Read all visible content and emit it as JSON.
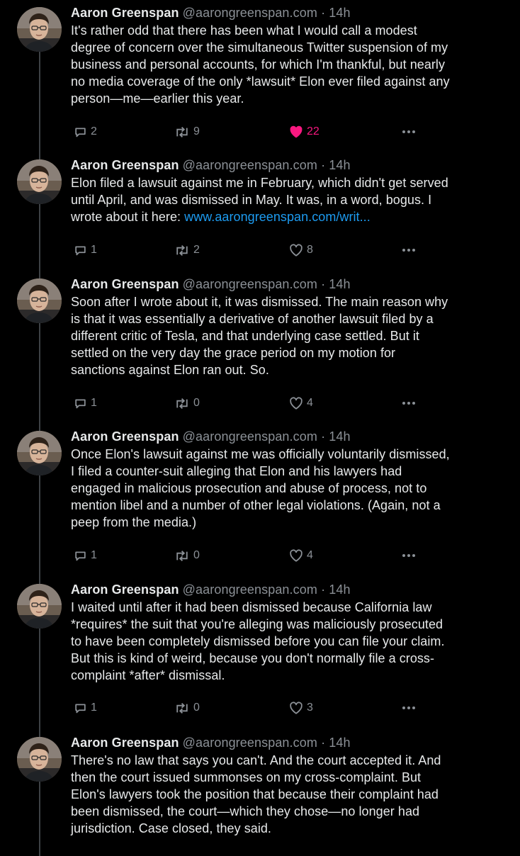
{
  "colors": {
    "background": "#000000",
    "text": "#e7e9ea",
    "muted": "#8b9096",
    "link": "#1d9bf0",
    "like": "#f91880",
    "thread_line": "#3d4145"
  },
  "icons": {
    "reply": "speech-bubble-icon",
    "retweet": "retweet-arrows-icon",
    "like": "heart-icon",
    "more": "ellipsis-icon"
  },
  "tweets": [
    {
      "author": "Aaron Greenspan",
      "handle": "@aarongreenspan.com",
      "separator": "·",
      "time": "14h",
      "lines": [
        "It's rather odd that there has been what I would call a modest",
        "degree of concern over the simultaneous Twitter suspension of my",
        "business and personal accounts, for which I'm thankful, but nearly",
        "no media coverage of the only *lawsuit* Elon ever filed against any",
        "person—me—earlier this year."
      ],
      "replies": "2",
      "reposts": "9",
      "likes": "22",
      "liked": true
    },
    {
      "author": "Aaron Greenspan",
      "handle": "@aarongreenspan.com",
      "separator": "·",
      "time": "14h",
      "lines": [
        "Elon filed a lawsuit against me in February, which didn't get served",
        "until April, and was dismissed in May. It was, in a word, bogus. I"
      ],
      "last_line_prefix": "wrote about it here: ",
      "link_text": "www.aarongreenspan.com/writ...",
      "replies": "1",
      "reposts": "2",
      "likes": "8",
      "liked": false
    },
    {
      "author": "Aaron Greenspan",
      "handle": "@aarongreenspan.com",
      "separator": "·",
      "time": "14h",
      "lines": [
        "Soon after I wrote about it, it was dismissed. The main reason why",
        "is that it was essentially a derivative of another lawsuit filed by a",
        "different critic of Tesla, and that underlying case settled. But it",
        "settled on the very day the grace period on my motion for",
        "sanctions against Elon ran out. So."
      ],
      "replies": "1",
      "reposts": "0",
      "likes": "4",
      "liked": false
    },
    {
      "author": "Aaron Greenspan",
      "handle": "@aarongreenspan.com",
      "separator": "·",
      "time": "14h",
      "lines": [
        "Once Elon's lawsuit against me was officially voluntarily dismissed,",
        "I filed a counter-suit alleging that Elon and his lawyers had",
        "engaged in malicious prosecution and abuse of process, not to",
        "mention libel and a number of other legal violations. (Again, not a",
        "peep from the media.)"
      ],
      "replies": "1",
      "reposts": "0",
      "likes": "4",
      "liked": false
    },
    {
      "author": "Aaron Greenspan",
      "handle": "@aarongreenspan.com",
      "separator": "·",
      "time": "14h",
      "lines": [
        "I waited until after it had been dismissed because California law",
        "*requires* the suit that you're alleging was maliciously prosecuted",
        "to have been completely dismissed before you can file your claim.",
        "But this is kind of weird, because you don't normally file a cross-",
        "complaint *after* dismissal."
      ],
      "replies": "1",
      "reposts": "0",
      "likes": "3",
      "liked": false
    },
    {
      "author": "Aaron Greenspan",
      "handle": "@aarongreenspan.com",
      "separator": "·",
      "time": "14h",
      "lines": [
        "There's no law that says you can't. And the court accepted it. And",
        "then the court issued summonses on my cross-complaint. But",
        "Elon's lawyers took the position that because their complaint had",
        "been dismissed, the court—which they chose—no longer had",
        "jurisdiction. Case closed, they said."
      ]
    }
  ]
}
